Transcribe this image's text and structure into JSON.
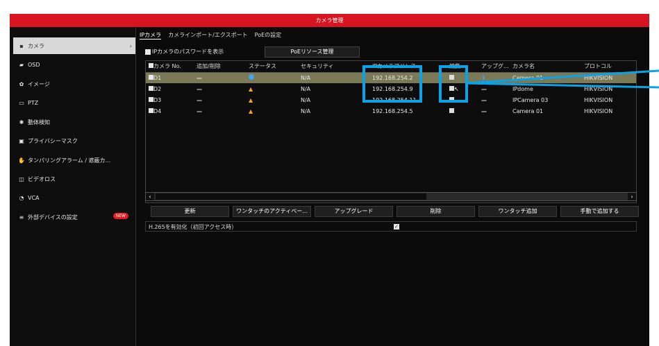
{
  "window": {
    "title": "カメラ管理"
  },
  "sidebar": {
    "items": [
      {
        "label": "カメラ",
        "icon": "camera-icon",
        "glyph": "▪",
        "active": true
      },
      {
        "label": "OSD",
        "icon": "osd-icon",
        "glyph": "▰"
      },
      {
        "label": "イメージ",
        "icon": "image-icon",
        "glyph": "✿"
      },
      {
        "label": "PTZ",
        "icon": "ptz-icon",
        "glyph": "▭"
      },
      {
        "label": "動体検知",
        "icon": "motion-icon",
        "glyph": "✱"
      },
      {
        "label": "プライバシーマスク",
        "icon": "privacy-mask-icon",
        "glyph": "▣"
      },
      {
        "label": "タンパリングアラーム / 遮蔽カ...",
        "icon": "tamper-icon",
        "glyph": "✋"
      },
      {
        "label": "ビデオロス",
        "icon": "video-loss-icon",
        "glyph": "◫"
      },
      {
        "label": "VCA",
        "icon": "vca-icon",
        "glyph": "◔"
      },
      {
        "label": "外部デバイスの設定",
        "icon": "external-device-icon",
        "glyph": "≡",
        "badge": "NEW"
      }
    ]
  },
  "tabs": [
    "IPカメラ",
    "カメラインポート/エクスポート",
    "PoEの設定"
  ],
  "show_password_label": "IPカメラのパスワードを表示",
  "poe_button": "PoEリソース管理",
  "table": {
    "headers": [
      "カメラ No.",
      "追加/削除",
      "ステータス",
      "セキュリティ",
      "IPカメラアドレス",
      "編集",
      "アップグ...",
      "カメラ名",
      "プロトコル"
    ],
    "rows": [
      {
        "no": "D1",
        "add": "—",
        "status": "play",
        "security": "N/A",
        "ip": "192.168.254.2",
        "upgrade": "arrow",
        "name": "Camera 01",
        "protocol": "HIKVISION"
      },
      {
        "no": "D2",
        "add": "—",
        "status": "warn",
        "security": "N/A",
        "ip": "192.168.254.9",
        "upgrade": "—",
        "name": "IPdome",
        "protocol": "HIKVISION"
      },
      {
        "no": "D3",
        "add": "—",
        "status": "warn",
        "security": "N/A",
        "ip": "192.168.254.11",
        "upgrade": "—",
        "name": "IPCamera 03",
        "protocol": "HIKVISION"
      },
      {
        "no": "D4",
        "add": "—",
        "status": "warn",
        "security": "N/A",
        "ip": "192.168.254.5",
        "upgrade": "—",
        "name": "Camera 01",
        "protocol": "HIKVISION"
      }
    ]
  },
  "buttons": {
    "refresh": "更新",
    "one_touch_activate": "ワンタッチのアクティベー...",
    "upgrade": "アップグレード",
    "delete": "削除",
    "one_touch_add": "ワンタッチ追加",
    "manual_add": "手動で追加する"
  },
  "h265_label": "H.265を有効化（初回アクセス時）",
  "colors": {
    "accent": "#d7141f",
    "highlight": "#0aa3e8",
    "selected_row": "#7b7a58"
  }
}
